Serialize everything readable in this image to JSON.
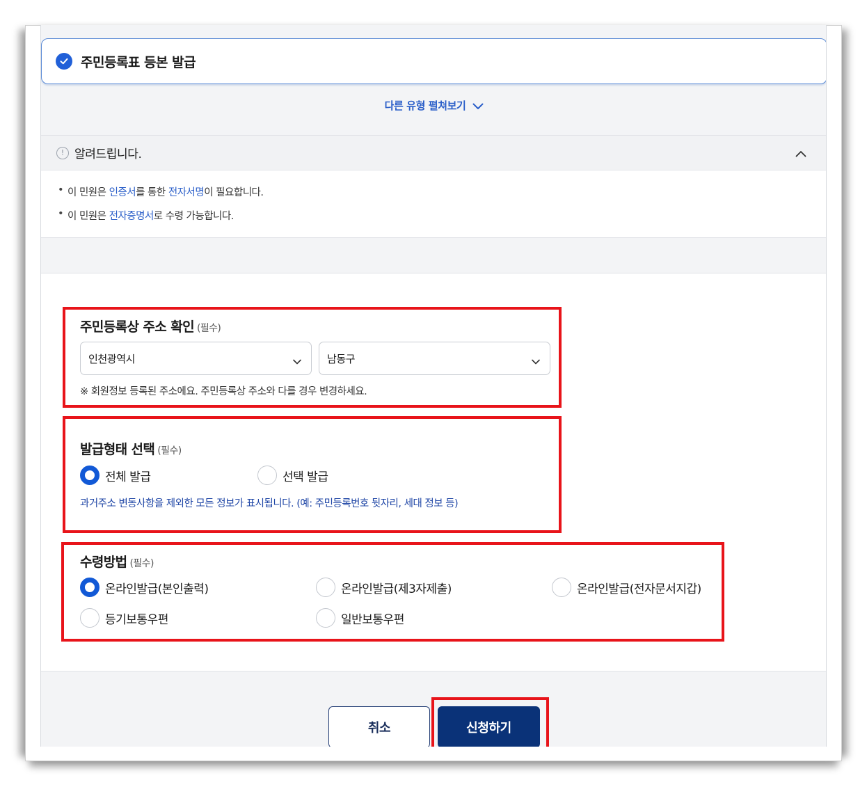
{
  "title_card": {
    "title": "주민등록표 등본 발급"
  },
  "expand_link": {
    "label": "다른 유형 펼쳐보기"
  },
  "notice": {
    "title": "알려드립니다.",
    "items": [
      {
        "pre": "이 민원은 ",
        "link1": "인증서",
        "mid": "를 통한 ",
        "link2": "전자서명",
        "post": "이 필요합니다."
      },
      {
        "pre": "이 민원은 ",
        "link1": "전자증명서",
        "post": "로 수령 가능합니다."
      }
    ]
  },
  "address_section": {
    "title": "주민등록상 주소 확인",
    "required": "(필수)",
    "city_value": "인천광역시",
    "district_value": "남동구",
    "note": "※ 회원정보 등록된 주소에요. 주민등록상 주소와 다를 경우 변경하세요."
  },
  "issue_type_section": {
    "title": "발급형태 선택",
    "required": "(필수)",
    "options": [
      {
        "label": "전체 발급",
        "selected": true
      },
      {
        "label": "선택 발급",
        "selected": false
      }
    ],
    "note": "과거주소 변동사항을 제외한 모든 정보가 표시됩니다. (예: 주민등록번호 뒷자리, 세대 정보 등)"
  },
  "receive_section": {
    "title": "수령방법",
    "required": "(필수)",
    "options": [
      {
        "label": "온라인발급(본인출력)",
        "selected": true
      },
      {
        "label": "온라인발급(제3자제출)",
        "selected": false
      },
      {
        "label": "온라인발급(전자문서지갑)",
        "selected": false
      },
      {
        "label": "등기보통우편",
        "selected": false
      },
      {
        "label": "일반보통우편",
        "selected": false
      }
    ]
  },
  "buttons": {
    "cancel": "취소",
    "submit": "신청하기"
  },
  "colors": {
    "accent": "#2160d8",
    "highlight_box": "#e8141a",
    "submit_bg": "#0a3278"
  },
  "icons": [
    "check-circle-icon",
    "chevron-down-icon",
    "info-icon",
    "chevron-up-icon"
  ]
}
